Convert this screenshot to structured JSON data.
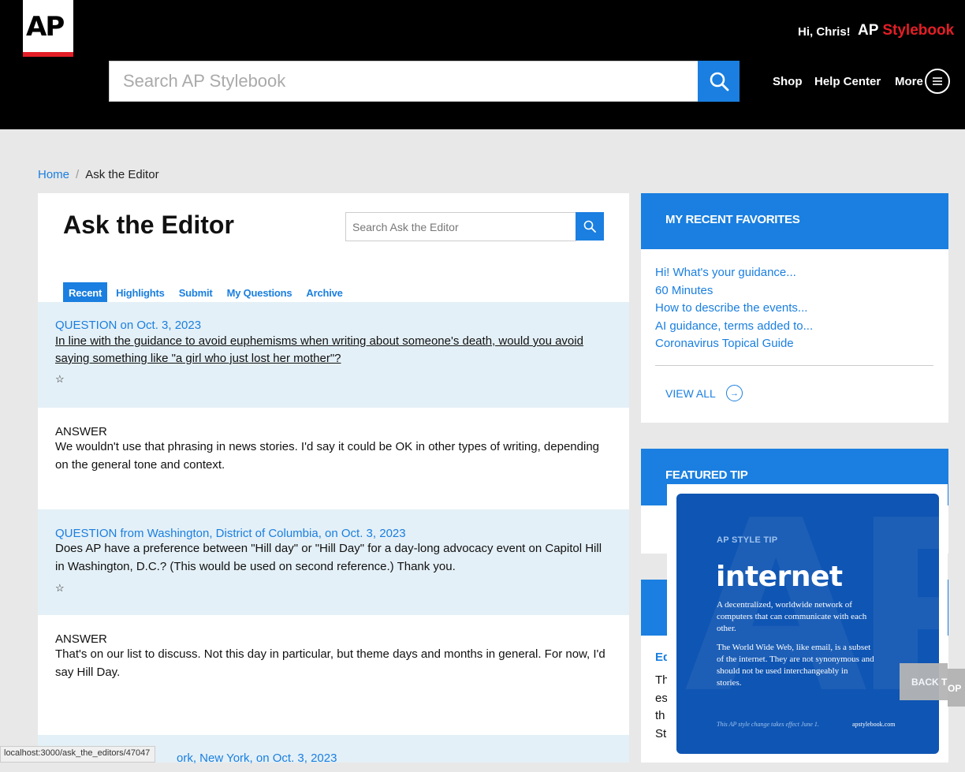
{
  "header": {
    "logo_text": "AP",
    "greeting": "Hi, Chris!",
    "brand_ap": "AP",
    "brand_stylebook": "Stylebook",
    "search_placeholder": "Search AP Stylebook",
    "nav": {
      "shop": "Shop",
      "help": "Help Center",
      "more": "More"
    }
  },
  "breadcrumb": {
    "home": "Home",
    "current": "Ask the Editor"
  },
  "main": {
    "title": "Ask the Editor",
    "search_placeholder": "Search Ask the Editor",
    "tabs": [
      {
        "label": "Recent",
        "active": true
      },
      {
        "label": "Highlights"
      },
      {
        "label": "Submit"
      },
      {
        "label": "My Questions"
      },
      {
        "label": "Archive"
      }
    ],
    "entries": [
      {
        "question_label": "QUESTION on Oct. 3, 2023",
        "question_text": "In line with the guidance to avoid euphemisms when writing about someone's death, would you avoid saying something like \"a girl who just lost her mother\"?",
        "star": "☆",
        "answer_label": "ANSWER",
        "answer_text": "We wouldn't use that phrasing in news stories. I'd say it could be OK in other types of writing, depending on the general tone and context."
      },
      {
        "question_label": "QUESTION from Washington, District of Columbia, on Oct. 3, 2023",
        "question_text": "Does AP have a preference between \"Hill day\" or \"Hill Day\" for a day-long advocacy event on Capitol Hill in Washington, D.C.? (This would be used on second reference.) Thank you.",
        "star": "☆",
        "answer_label": "ANSWER",
        "answer_text": "That's on our list to discuss. Not this day in particular, but theme days and months in general. For now, I'd say Hill Day."
      }
    ],
    "peek_text": "ork, New York, on Oct. 3, 2023"
  },
  "sidebar": {
    "favorites": {
      "title": "MY RECENT FAVORITES",
      "items": [
        "Hi! What's your guidance...",
        "60 Minutes",
        "How to describe the events...",
        "AI guidance, terms added to...",
        "Coronavirus Topical Guide"
      ],
      "view_all": "VIEW ALL"
    },
    "featured_tip": {
      "title": "FEATURED TIP",
      "kicker": "AP STYLE TIP",
      "word": "internet",
      "definition": "A decentralized, worldwide network of computers that can communicate with each other.",
      "body": "The World Wide Web, like email, is a subset of the internet. They are not synonymous and should not be used interchangeably in stories.",
      "footer": "This AP style change takes effect June 1.",
      "url": "apstylebook.com"
    },
    "editor_panel": {
      "link": "Ed",
      "text_lines": [
        "Th",
        "es",
        "th",
        "St"
      ]
    }
  },
  "back_to_top": {
    "label": "BACK T",
    "label_2": "OP"
  },
  "status_url": "localhost:3000/ask_the_editors/47047",
  "colors": {
    "accent": "#1a7fe0",
    "brand_red": "#e41e26",
    "header_bg": "#000000",
    "question_bg": "#e4f0f7",
    "tip_bg": "#0f55b3"
  }
}
